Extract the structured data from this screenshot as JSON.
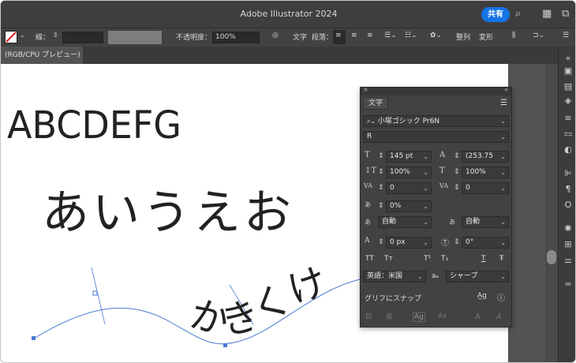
{
  "window": {
    "title": "Adobe Illustrator 2024",
    "share_label": "共有"
  },
  "control_bar": {
    "stroke_label": "線：",
    "opacity_label": "不透明度：",
    "opacity_value": "100%",
    "text_label": "文字",
    "paragraph_label": "段落：",
    "align_label": "整列",
    "transform_label": "変形"
  },
  "document_tab": {
    "label": "(RGB/CPU プレビュー)"
  },
  "artwork": {
    "latin_text": "ABCDEFG",
    "hiragana_text": "あいうえお",
    "path_text": "かきくけこ"
  },
  "character_panel": {
    "tab_label": "文字",
    "font_family": "小塚ゴシック Pr6N",
    "font_style": "R",
    "font_size": "145 pt",
    "leading": "(253.75",
    "vertical_scale": "100%",
    "horizontal_scale": "100%",
    "kerning": "0",
    "tracking": "0",
    "tsume": "0%",
    "aki_left": "自動",
    "aki_right": "自動",
    "baseline_shift": "0 px",
    "rotation": "0°",
    "language": "英語：米国",
    "antialias": "シャープ",
    "snap_to_glyph": "グリフにスナップ",
    "style_buttons": [
      "TT",
      "Tт",
      "T¹",
      "T₁",
      "T",
      "Ŧ"
    ]
  },
  "colors": {
    "accent": "#1473e6",
    "panel_bg": "#424242",
    "path_stroke": "#4a7bd0"
  }
}
